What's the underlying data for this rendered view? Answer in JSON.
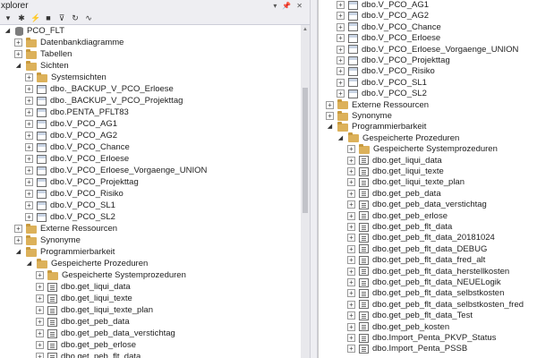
{
  "window": {
    "title": "xplorer",
    "controls": [
      "▾",
      "📌",
      "✕"
    ]
  },
  "toolbar": {
    "icons": [
      "connect-icon",
      "new-query-icon",
      "disconnect-icon",
      "stop-icon",
      "filter-icon",
      "refresh-icon",
      "activity-icon"
    ]
  },
  "left_tree": [
    {
      "level": 0,
      "expander": "open",
      "icon": "db",
      "label": "PCO_FLT"
    },
    {
      "level": 1,
      "expander": "closed",
      "icon": "folder",
      "label": "Datenbankdiagramme"
    },
    {
      "level": 1,
      "expander": "closed",
      "icon": "folder",
      "label": "Tabellen"
    },
    {
      "level": 1,
      "expander": "open",
      "icon": "folder",
      "label": "Sichten"
    },
    {
      "level": 2,
      "expander": "closed",
      "icon": "folder",
      "label": "Systemsichten"
    },
    {
      "level": 2,
      "expander": "closed",
      "icon": "table",
      "label": "dbo._BACKUP_V_PCO_Erloese"
    },
    {
      "level": 2,
      "expander": "closed",
      "icon": "table",
      "label": "dbo._BACKUP_V_PCO_Projekttag"
    },
    {
      "level": 2,
      "expander": "closed",
      "icon": "table",
      "label": "dbo.PENTA_PFLT83"
    },
    {
      "level": 2,
      "expander": "closed",
      "icon": "table",
      "label": "dbo.V_PCO_AG1"
    },
    {
      "level": 2,
      "expander": "closed",
      "icon": "table",
      "label": "dbo.V_PCO_AG2"
    },
    {
      "level": 2,
      "expander": "closed",
      "icon": "table",
      "label": "dbo.V_PCO_Chance"
    },
    {
      "level": 2,
      "expander": "closed",
      "icon": "table",
      "label": "dbo.V_PCO_Erloese"
    },
    {
      "level": 2,
      "expander": "closed",
      "icon": "table",
      "label": "dbo.V_PCO_Erloese_Vorgaenge_UNION"
    },
    {
      "level": 2,
      "expander": "closed",
      "icon": "table",
      "label": "dbo.V_PCO_Projekttag"
    },
    {
      "level": 2,
      "expander": "closed",
      "icon": "table",
      "label": "dbo.V_PCO_Risiko"
    },
    {
      "level": 2,
      "expander": "closed",
      "icon": "table",
      "label": "dbo.V_PCO_SL1"
    },
    {
      "level": 2,
      "expander": "closed",
      "icon": "table",
      "label": "dbo.V_PCO_SL2"
    },
    {
      "level": 1,
      "expander": "closed",
      "icon": "folder",
      "label": "Externe Ressourcen"
    },
    {
      "level": 1,
      "expander": "closed",
      "icon": "folder",
      "label": "Synonyme"
    },
    {
      "level": 1,
      "expander": "open",
      "icon": "folder",
      "label": "Programmierbarkeit"
    },
    {
      "level": 2,
      "expander": "open",
      "icon": "folder",
      "label": "Gespeicherte Prozeduren"
    },
    {
      "level": 3,
      "expander": "closed",
      "icon": "folder",
      "label": "Gespeicherte Systemprozeduren"
    },
    {
      "level": 3,
      "expander": "closed",
      "icon": "proc",
      "label": "dbo.get_liqui_data"
    },
    {
      "level": 3,
      "expander": "closed",
      "icon": "proc",
      "label": "dbo.get_liqui_texte"
    },
    {
      "level": 3,
      "expander": "closed",
      "icon": "proc",
      "label": "dbo.get_liqui_texte_plan"
    },
    {
      "level": 3,
      "expander": "closed",
      "icon": "proc",
      "label": "dbo.get_peb_data"
    },
    {
      "level": 3,
      "expander": "closed",
      "icon": "proc",
      "label": "dbo.get_peb_data_verstichtag"
    },
    {
      "level": 3,
      "expander": "closed",
      "icon": "proc",
      "label": "dbo.get_peb_erlose"
    },
    {
      "level": 3,
      "expander": "closed",
      "icon": "proc",
      "label": "dbo.get_peb_flt_data"
    }
  ],
  "right_tree": [
    {
      "level": 2,
      "expander": "closed",
      "icon": "table",
      "label": "dbo.V_PCO_AG1"
    },
    {
      "level": 2,
      "expander": "closed",
      "icon": "table",
      "label": "dbo.V_PCO_AG2"
    },
    {
      "level": 2,
      "expander": "closed",
      "icon": "table",
      "label": "dbo.V_PCO_Chance"
    },
    {
      "level": 2,
      "expander": "closed",
      "icon": "table",
      "label": "dbo.V_PCO_Erloese"
    },
    {
      "level": 2,
      "expander": "closed",
      "icon": "table",
      "label": "dbo.V_PCO_Erloese_Vorgaenge_UNION"
    },
    {
      "level": 2,
      "expander": "closed",
      "icon": "table",
      "label": "dbo.V_PCO_Projekttag"
    },
    {
      "level": 2,
      "expander": "closed",
      "icon": "table",
      "label": "dbo.V_PCO_Risiko"
    },
    {
      "level": 2,
      "expander": "closed",
      "icon": "table",
      "label": "dbo.V_PCO_SL1"
    },
    {
      "level": 2,
      "expander": "closed",
      "icon": "table",
      "label": "dbo.V_PCO_SL2"
    },
    {
      "level": 1,
      "expander": "closed",
      "icon": "folder",
      "label": "Externe Ressourcen"
    },
    {
      "level": 1,
      "expander": "closed",
      "icon": "folder",
      "label": "Synonyme"
    },
    {
      "level": 1,
      "expander": "open",
      "icon": "folder",
      "label": "Programmierbarkeit"
    },
    {
      "level": 2,
      "expander": "open",
      "icon": "folder",
      "label": "Gespeicherte Prozeduren"
    },
    {
      "level": 3,
      "expander": "closed",
      "icon": "folder",
      "label": "Gespeicherte Systemprozeduren"
    },
    {
      "level": 3,
      "expander": "closed",
      "icon": "proc",
      "label": "dbo.get_liqui_data"
    },
    {
      "level": 3,
      "expander": "closed",
      "icon": "proc",
      "label": "dbo.get_liqui_texte"
    },
    {
      "level": 3,
      "expander": "closed",
      "icon": "proc",
      "label": "dbo.get_liqui_texte_plan"
    },
    {
      "level": 3,
      "expander": "closed",
      "icon": "proc",
      "label": "dbo.get_peb_data"
    },
    {
      "level": 3,
      "expander": "closed",
      "icon": "proc",
      "label": "dbo.get_peb_data_verstichtag"
    },
    {
      "level": 3,
      "expander": "closed",
      "icon": "proc",
      "label": "dbo.get_peb_erlose"
    },
    {
      "level": 3,
      "expander": "closed",
      "icon": "proc",
      "label": "dbo.get_peb_flt_data"
    },
    {
      "level": 3,
      "expander": "closed",
      "icon": "proc",
      "label": "dbo.get_peb_flt_data_20181024"
    },
    {
      "level": 3,
      "expander": "closed",
      "icon": "proc",
      "label": "dbo.get_peb_flt_data_DEBUG"
    },
    {
      "level": 3,
      "expander": "closed",
      "icon": "proc",
      "label": "dbo.get_peb_flt_data_fred_alt"
    },
    {
      "level": 3,
      "expander": "closed",
      "icon": "proc",
      "label": "dbo.get_peb_flt_data_herstellkosten"
    },
    {
      "level": 3,
      "expander": "closed",
      "icon": "proc",
      "label": "dbo.get_peb_flt_data_NEUELogik"
    },
    {
      "level": 3,
      "expander": "closed",
      "icon": "proc",
      "label": "dbo.get_peb_flt_data_selbstkosten"
    },
    {
      "level": 3,
      "expander": "closed",
      "icon": "proc",
      "label": "dbo.get_peb_flt_data_selbstkosten_fred"
    },
    {
      "level": 3,
      "expander": "closed",
      "icon": "proc",
      "label": "dbo.get_peb_flt_data_Test"
    },
    {
      "level": 3,
      "expander": "closed",
      "icon": "proc",
      "label": "dbo.get_peb_kosten"
    },
    {
      "level": 3,
      "expander": "closed",
      "icon": "proc",
      "label": "dbo.Import_Penta_PKVP_Status"
    },
    {
      "level": 3,
      "expander": "closed",
      "icon": "proc",
      "label": "dbo.Import_Penta_PSSB"
    }
  ]
}
